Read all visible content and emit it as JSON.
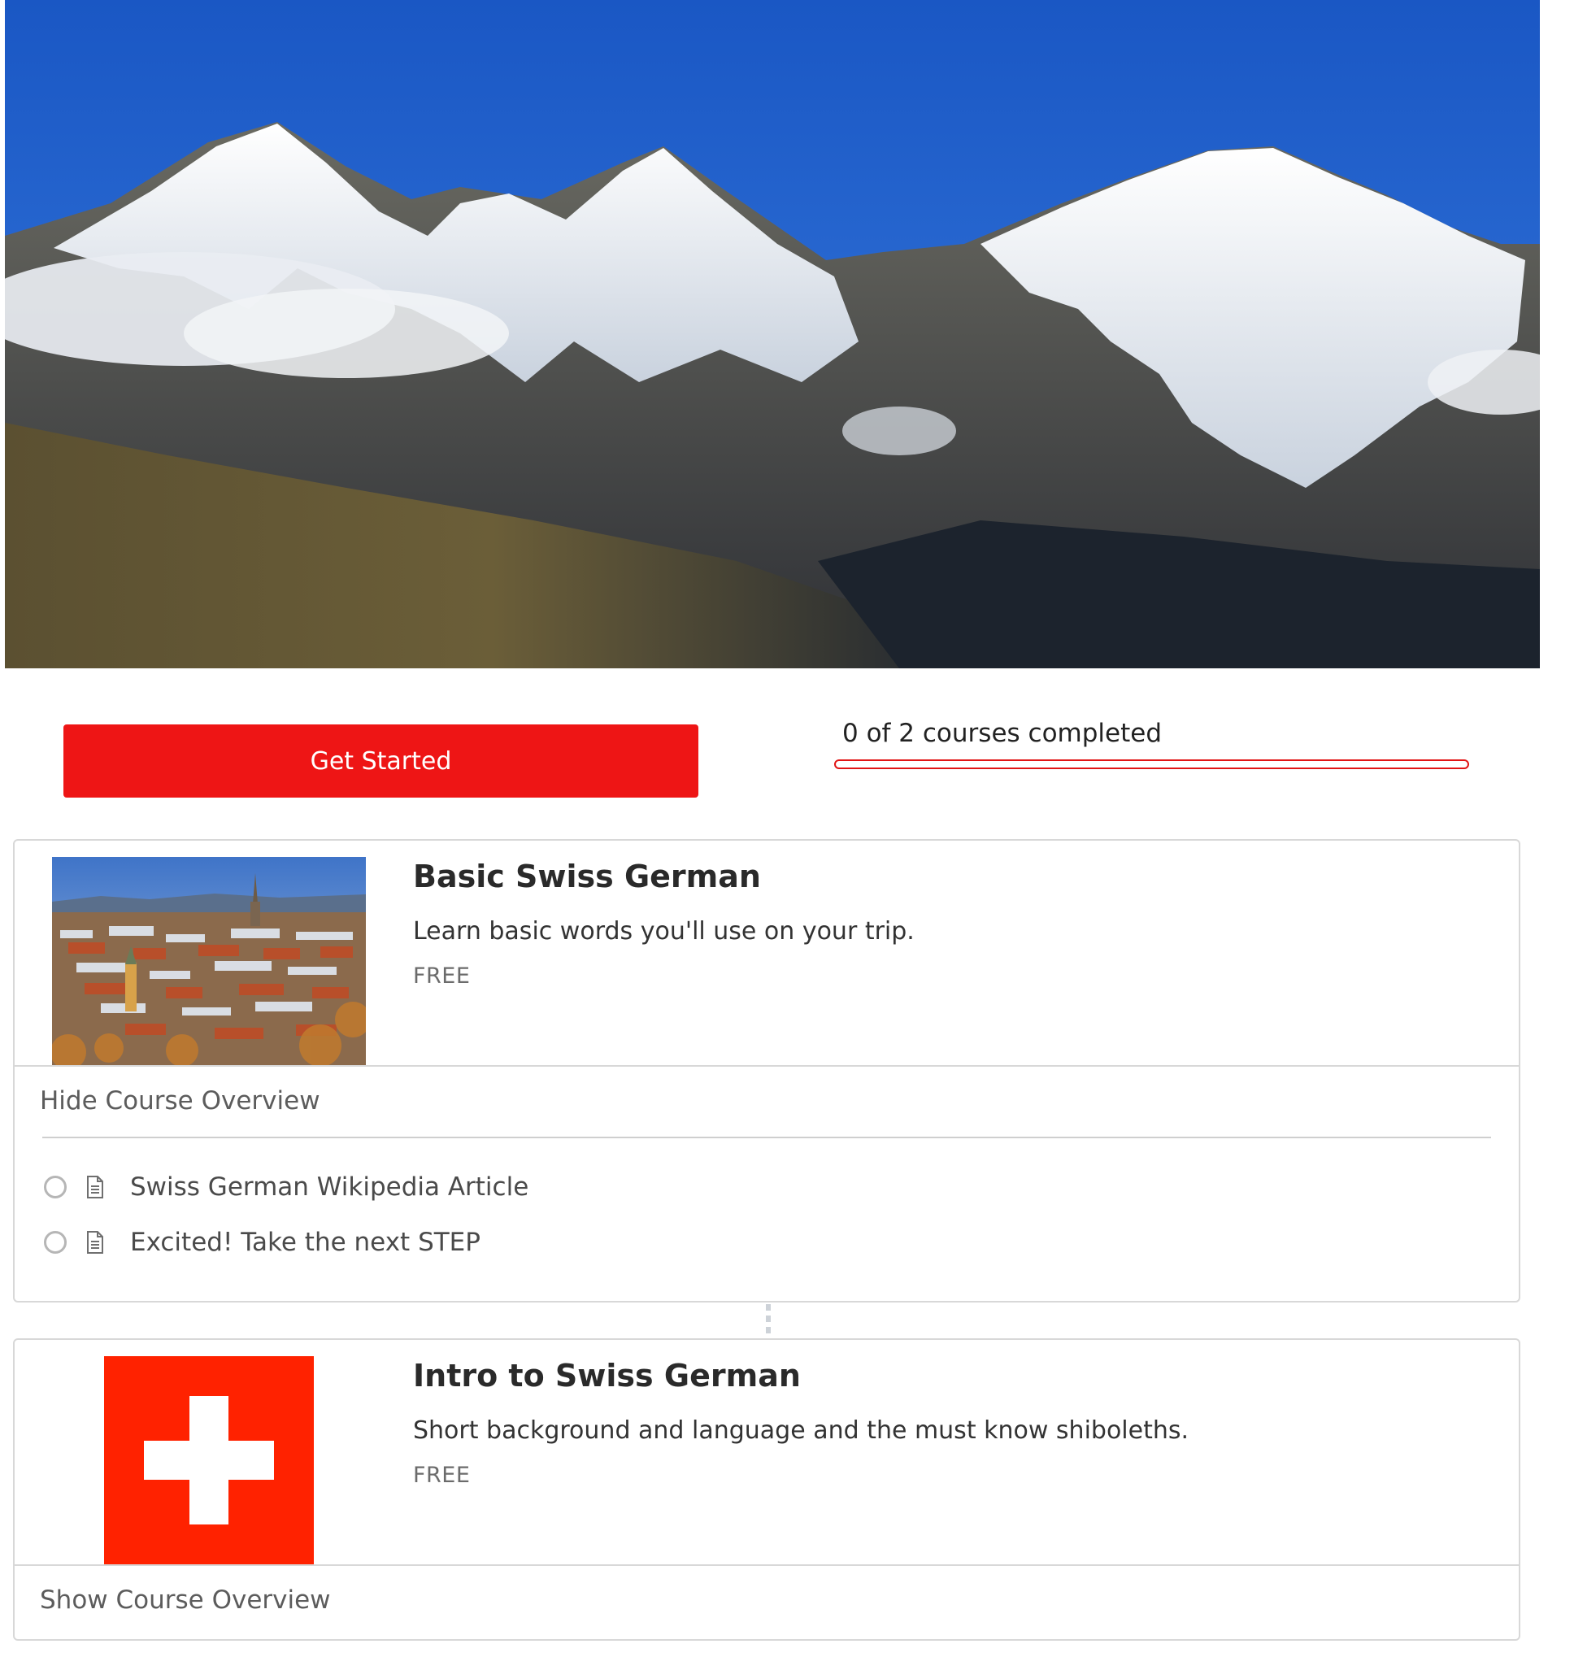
{
  "hero": {
    "image": "alpine-mountains-banner"
  },
  "progress": {
    "button_label": "Get Started",
    "status_text": "0 of 2 courses completed",
    "completed": 0,
    "total": 2,
    "accent_color": "#e11414"
  },
  "courses": [
    {
      "title": "Basic Swiss German",
      "description": "Learn basic words you'll use on your trip.",
      "price": "FREE",
      "thumbnail": "bern-old-town-photo",
      "overview_toggle": "Hide Course Overview",
      "lessons": [
        {
          "label": "Swiss German Wikipedia Article",
          "icon": "document-icon",
          "completed": false
        },
        {
          "label": "Excited! Take the next STEP",
          "icon": "document-icon",
          "completed": false
        }
      ]
    },
    {
      "title": "Intro to Swiss German",
      "description": "Short background and language and the must know shiboleths.",
      "price": "FREE",
      "thumbnail": "swiss-flag",
      "overview_toggle": "Show Course Overview"
    }
  ]
}
